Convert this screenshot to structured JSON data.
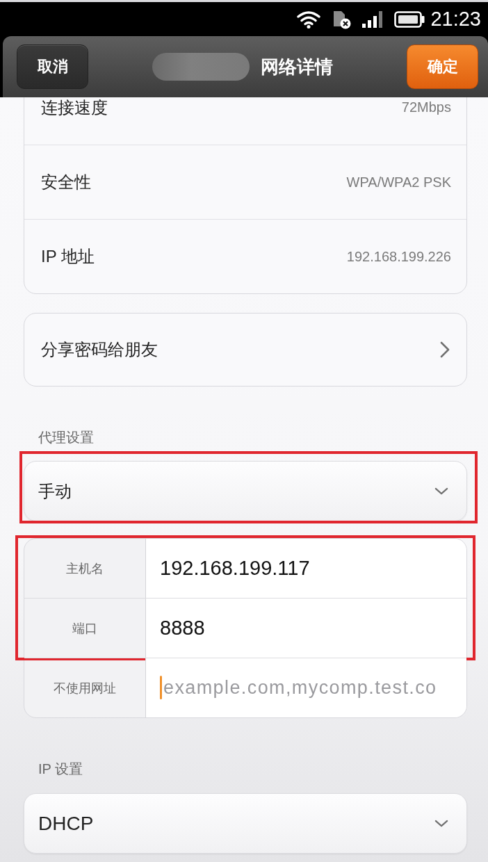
{
  "status_bar": {
    "time": "21:23"
  },
  "header": {
    "cancel": "取消",
    "title": "网络详情",
    "title_redacted": true,
    "confirm": "确定"
  },
  "details": [
    {
      "label": "连接速度",
      "value": "72Mbps"
    },
    {
      "label": "安全性",
      "value": "WPA/WPA2 PSK"
    },
    {
      "label": "IP 地址",
      "value": "192.168.199.226"
    }
  ],
  "share": {
    "label": "分享密码给朋友"
  },
  "proxy": {
    "heading": "代理设置",
    "mode": {
      "value": "手动",
      "highlighted": true
    },
    "field_groups": [
      {
        "highlighted": true,
        "fields": [
          {
            "label": "主机名",
            "value": "192.168.199.117",
            "focused": false
          },
          {
            "label": "端口",
            "value": "8888",
            "focused": false
          }
        ]
      },
      {
        "highlighted": false,
        "fields": [
          {
            "label": "不使用网址",
            "placeholder": "example.com,mycomp.test.co",
            "focused": true
          }
        ]
      }
    ]
  },
  "ip": {
    "heading": "IP 设置",
    "mode": {
      "value": "DHCP",
      "highlighted": false
    }
  }
}
